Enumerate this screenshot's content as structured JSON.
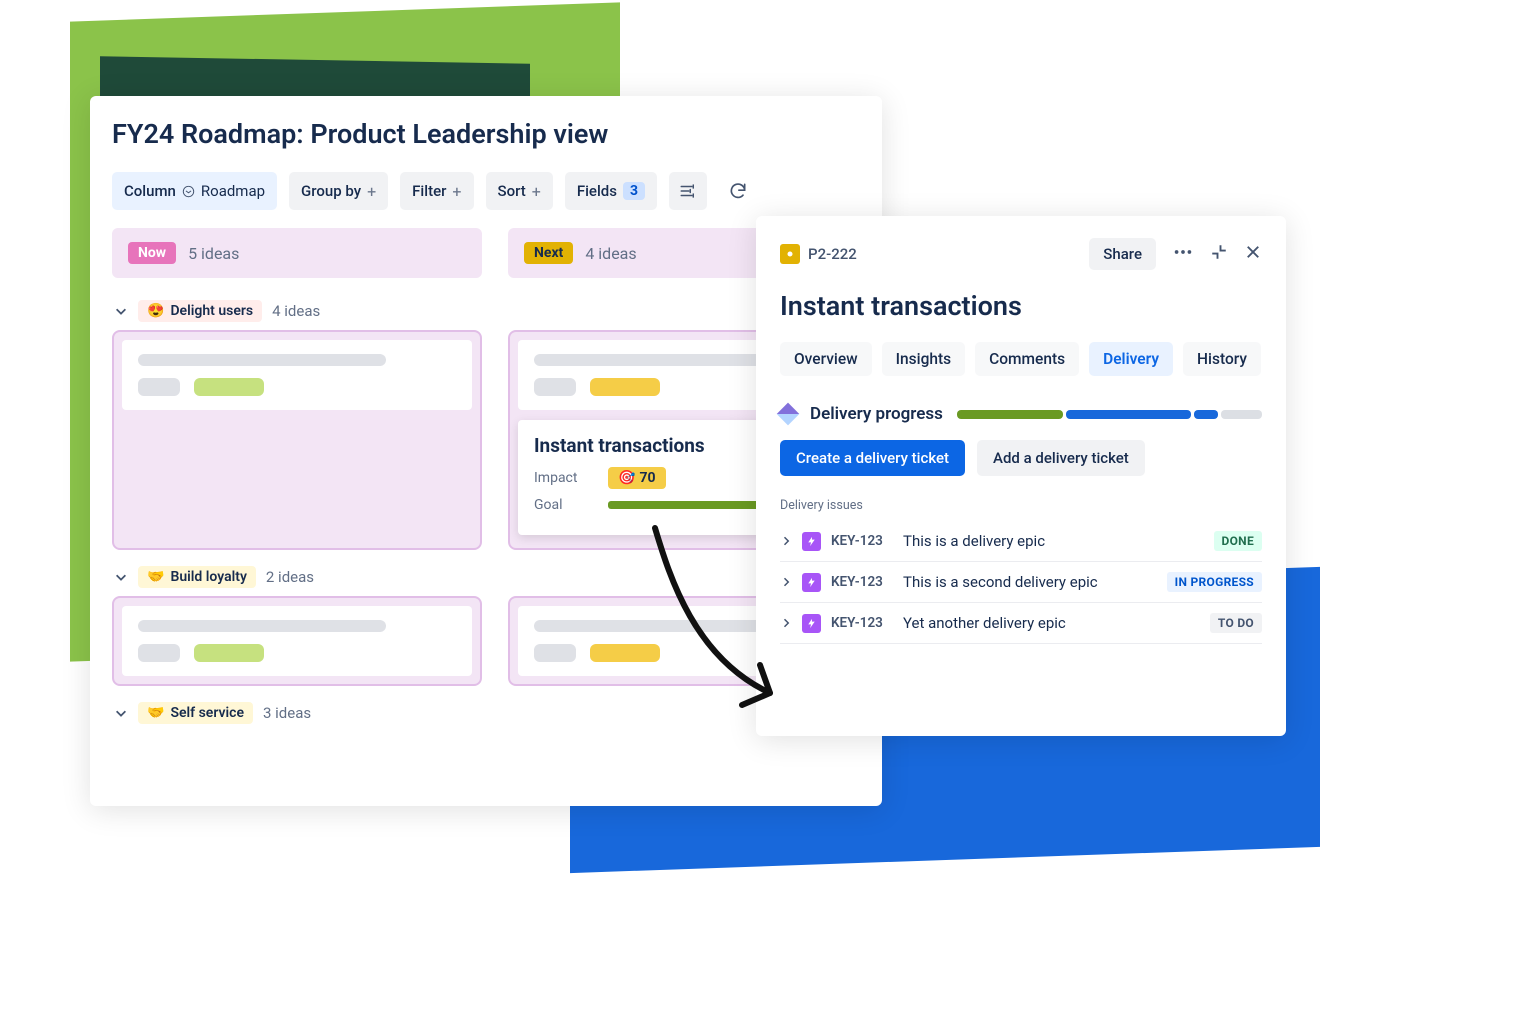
{
  "roadmap": {
    "title": "FY24 Roadmap: Product Leadership view",
    "toolbar": {
      "column_label": "Column",
      "column_value": "Roadmap",
      "group_by": "Group by",
      "filter": "Filter",
      "sort": "Sort",
      "fields": "Fields",
      "fields_count": "3"
    },
    "columns": [
      {
        "pill": "Now",
        "count": "5 ideas"
      },
      {
        "pill": "Next",
        "count": "4 ideas"
      }
    ],
    "groups": [
      {
        "emoji": "😍",
        "label": "Delight users",
        "count": "4 ideas"
      },
      {
        "emoji": "🤝",
        "label": "Build loyalty",
        "count": "2 ideas"
      },
      {
        "emoji": "🤝",
        "label": "Self service",
        "count": "3 ideas"
      }
    ],
    "feature_card": {
      "title": "Instant transactions",
      "impact_label": "Impact",
      "impact_value": "70",
      "goal_label": "Goal"
    }
  },
  "detail": {
    "key": "P2-222",
    "share": "Share",
    "title": "Instant transactions",
    "tabs": [
      "Overview",
      "Insights",
      "Comments",
      "Delivery",
      "History"
    ],
    "active_tab": "Delivery",
    "progress_label": "Delivery progress",
    "progress_segments": [
      {
        "color": "#6a9a23",
        "width": 36
      },
      {
        "color": "#1868db",
        "width": 42
      },
      {
        "color": "#1868db",
        "width": 8
      },
      {
        "color": "#dcdfe4",
        "width": 14
      }
    ],
    "create_btn": "Create a delivery ticket",
    "add_btn": "Add a delivery ticket",
    "issues_label": "Delivery issues",
    "issues": [
      {
        "key": "KEY-123",
        "title": "This is a delivery epic",
        "status": "DONE",
        "status_class": "done"
      },
      {
        "key": "KEY-123",
        "title": "This is a second delivery epic",
        "status": "IN PROGRESS",
        "status_class": "progress"
      },
      {
        "key": "KEY-123",
        "title": "Yet another delivery epic",
        "status": "TO DO",
        "status_class": "todo"
      }
    ]
  }
}
